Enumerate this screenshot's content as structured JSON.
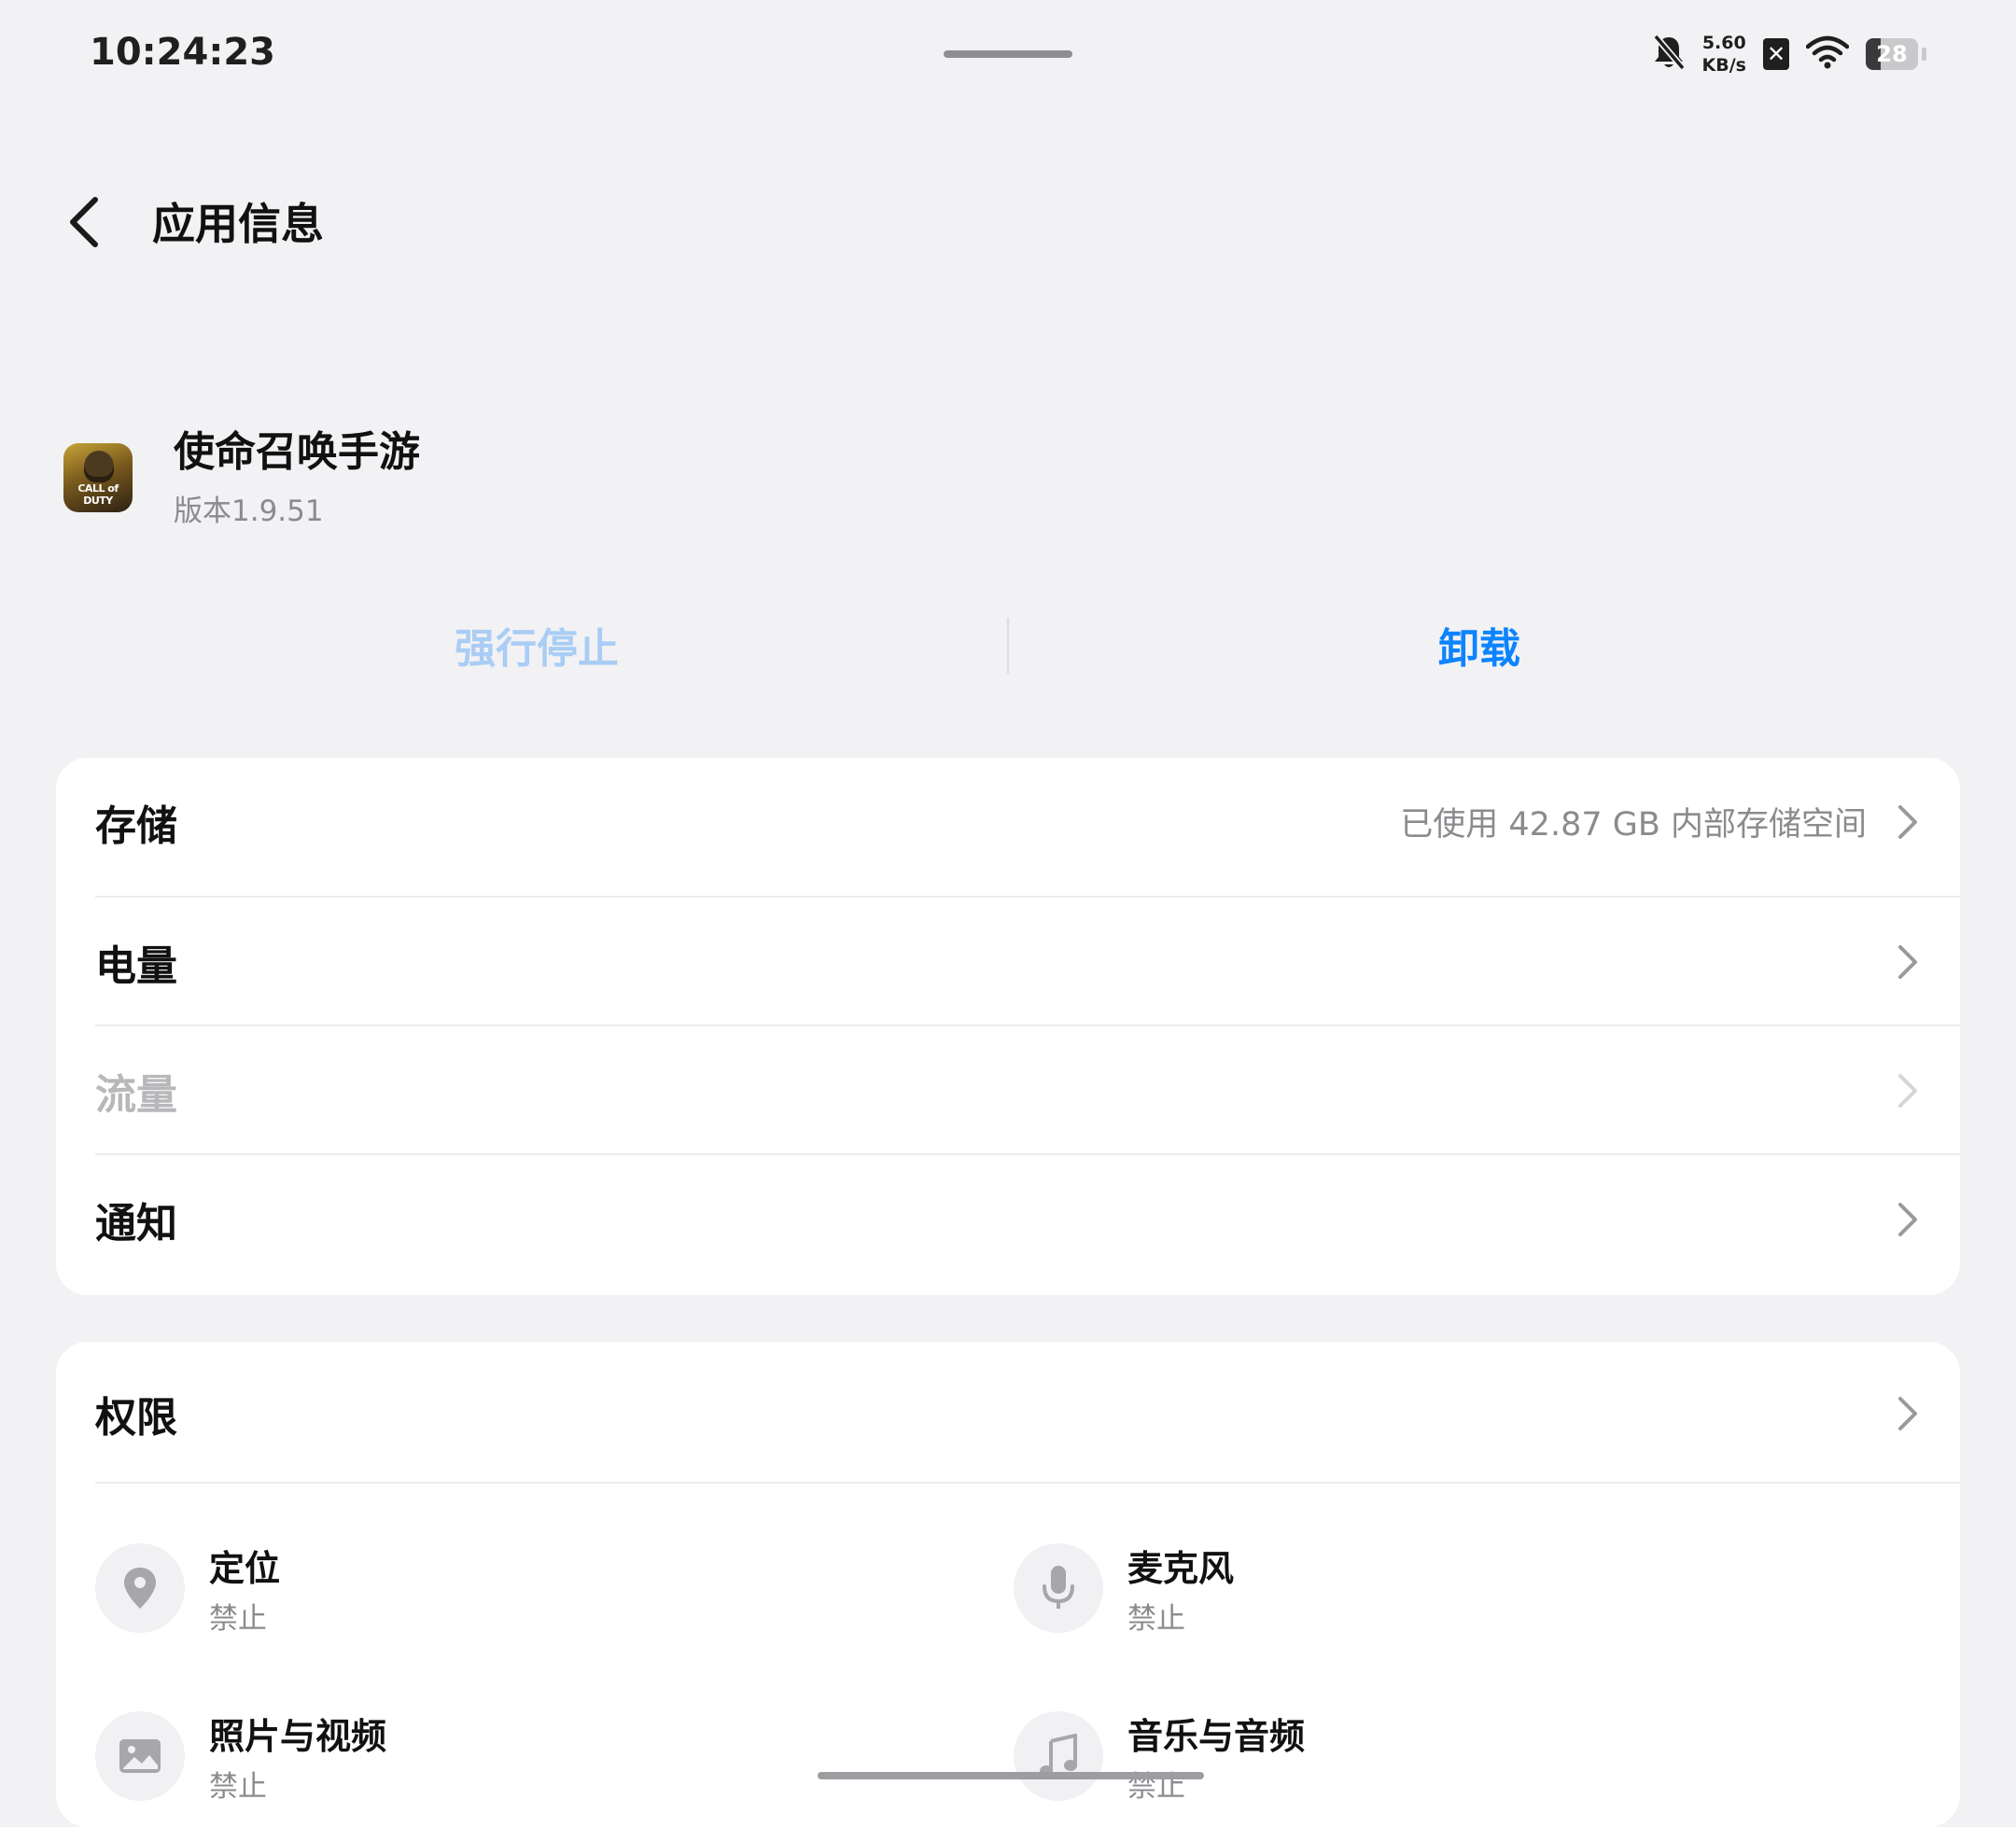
{
  "status_bar": {
    "time": "10:24:23",
    "net_speed_value": "5.60",
    "net_speed_unit": "KB/s",
    "sim_mark": "✕",
    "battery_level": "28",
    "battery_fraction": 0.28,
    "icons": [
      "bell-off-icon",
      "sim-disabled-icon",
      "wifi-icon",
      "battery-icon"
    ]
  },
  "header": {
    "title": "应用信息",
    "back_icon": "chevron-left-icon"
  },
  "app": {
    "name": "使命召唤手游",
    "version": "版本1.9.51",
    "icon_brand": "CALL of DUTY"
  },
  "actions": {
    "force_stop": "强行停止",
    "uninstall": "卸载",
    "force_stop_color": "#a9cdf5",
    "uninstall_color": "#0d84ff"
  },
  "settings": {
    "storage": {
      "label": "存储",
      "value": "已使用 42.87 GB 内部存储空间"
    },
    "battery": {
      "label": "电量"
    },
    "data_usage": {
      "label": "流量",
      "disabled": true
    },
    "notifications": {
      "label": "通知"
    }
  },
  "permissions": {
    "label": "权限",
    "items": [
      {
        "title": "定位",
        "status": "禁止",
        "icon": "location-pin-icon"
      },
      {
        "title": "麦克风",
        "status": "禁止",
        "icon": "microphone-icon"
      },
      {
        "title": "照片与视频",
        "status": "禁止",
        "icon": "image-icon"
      },
      {
        "title": "音乐与音频",
        "status": "禁止",
        "icon": "music-note-icon"
      }
    ]
  }
}
